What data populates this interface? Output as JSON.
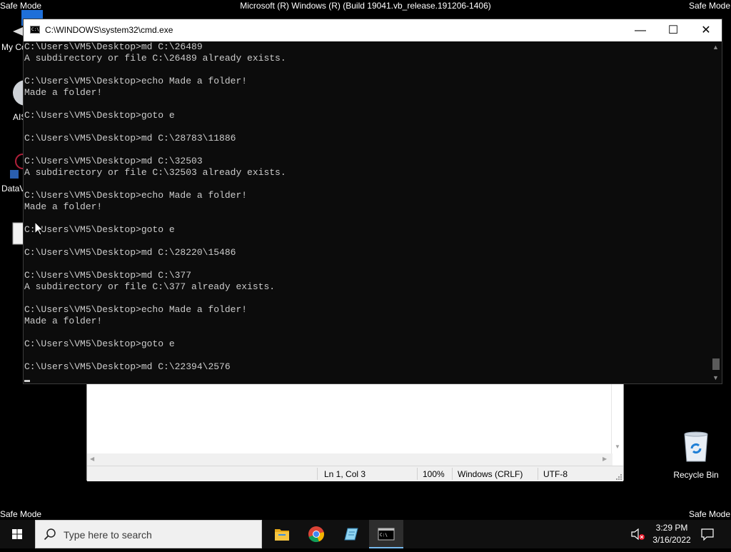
{
  "desktop": {
    "safe_mode_top_left": "Safe Mode",
    "safe_mode_top_right": "Safe Mode",
    "safe_mode_bottom_left": "Safe Mode",
    "safe_mode_bottom_right": "Safe Mode",
    "build_text": "Microsoft (R) Windows (R) (Build 19041.vb_release.191206-1406)",
    "icon_labels": [
      "My Co",
      "AIS",
      "DataV"
    ],
    "recycle_bin_label": "Recycle Bin"
  },
  "cmd": {
    "title": "C:\\WINDOWS\\system32\\cmd.exe",
    "icon_text": "C:\\",
    "minimize_glyph": "—",
    "maximize_glyph": "☐",
    "close_glyph": "✕",
    "lines": [
      "C:\\Users\\VM5\\Desktop>md C:\\26489",
      "A subdirectory or file C:\\26489 already exists.",
      "",
      "C:\\Users\\VM5\\Desktop>echo Made a folder!",
      "Made a folder!",
      "",
      "C:\\Users\\VM5\\Desktop>goto e",
      "",
      "C:\\Users\\VM5\\Desktop>md C:\\28783\\11886",
      "",
      "C:\\Users\\VM5\\Desktop>md C:\\32503",
      "A subdirectory or file C:\\32503 already exists.",
      "",
      "C:\\Users\\VM5\\Desktop>echo Made a folder!",
      "Made a folder!",
      "",
      "C:\\Users\\VM5\\Desktop>goto e",
      "",
      "C:\\Users\\VM5\\Desktop>md C:\\28220\\15486",
      "",
      "C:\\Users\\VM5\\Desktop>md C:\\377",
      "A subdirectory or file C:\\377 already exists.",
      "",
      "C:\\Users\\VM5\\Desktop>echo Made a folder!",
      "Made a folder!",
      "",
      "C:\\Users\\VM5\\Desktop>goto e",
      "",
      "C:\\Users\\VM5\\Desktop>md C:\\22394\\2576"
    ]
  },
  "notepad": {
    "status_position": "Ln 1, Col 3",
    "status_zoom": "100%",
    "status_line_ending": "Windows (CRLF)",
    "status_encoding": "UTF-8"
  },
  "taskbar": {
    "search_placeholder": "Type here to search",
    "clock_time": "3:29 PM",
    "clock_date": "3/16/2022",
    "pinned_apps": [
      "file-explorer",
      "chrome",
      "notepad-app",
      "cmd"
    ]
  },
  "colors": {
    "console_bg": "#0c0c0c",
    "console_text": "#cccccc",
    "taskbar_bg": "#101010",
    "active_indicator": "#76b9ed"
  }
}
